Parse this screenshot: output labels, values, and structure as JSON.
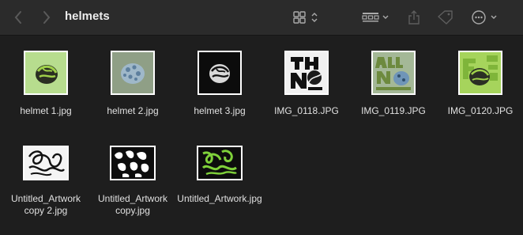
{
  "window": {
    "title": "helmets"
  },
  "toolbar": {
    "back_icon": "chevron-left-icon",
    "forward_icon": "chevron-right-icon",
    "view_icon": "icon-grid-view-icon",
    "group_icon": "group-by-icon",
    "share_icon": "share-icon",
    "tag_icon": "tag-icon",
    "more_icon": "ellipsis-circle-icon"
  },
  "files": [
    {
      "name": "helmet 1.jpg",
      "thumb": "helmet-green-bg"
    },
    {
      "name": "helmet 2.jpg",
      "thumb": "helmet-sage-bg"
    },
    {
      "name": "helmet 3.jpg",
      "thumb": "helmet-black-bg"
    },
    {
      "name": "IMG_0118.JPG",
      "thumb": "poster-the-new-season-bw"
    },
    {
      "name": "IMG_0119.JPG",
      "thumb": "poster-all-new-season"
    },
    {
      "name": "IMG_0120.JPG",
      "thumb": "poster-fresh-helmet"
    },
    {
      "name": "Untitled_Artwork copy 2.jpg",
      "thumb": "artwork-lettering-white"
    },
    {
      "name": "Untitled_Artwork copy.jpg",
      "thumb": "artwork-pattern-black"
    },
    {
      "name": "Untitled_Artwork.jpg",
      "thumb": "artwork-lettering-green"
    }
  ],
  "colors": {
    "accent_green": "#8cc63f",
    "sage": "#8f9f86",
    "background": "#1e1e1e"
  }
}
